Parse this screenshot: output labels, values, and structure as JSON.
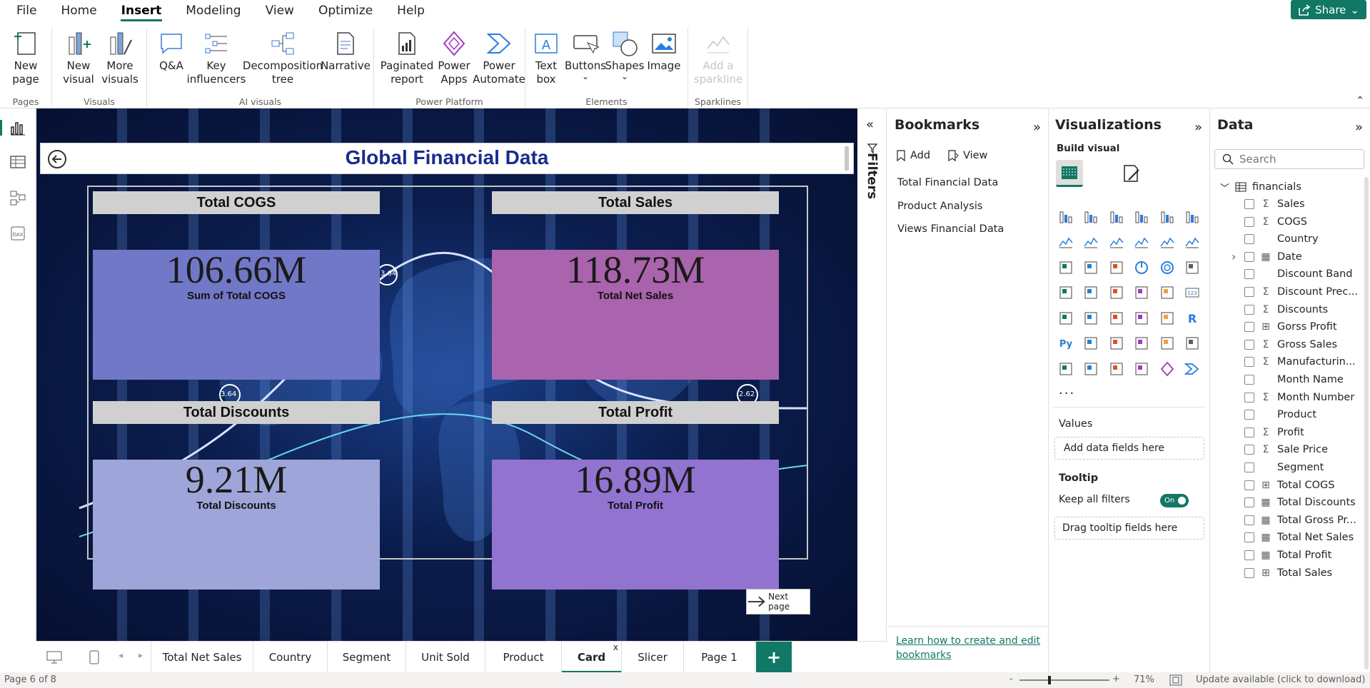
{
  "menu": {
    "items": [
      "File",
      "Home",
      "Insert",
      "Modeling",
      "View",
      "Optimize",
      "Help"
    ],
    "active": "Insert",
    "share_label": "Share"
  },
  "ribbon": {
    "groups": [
      {
        "label": "Pages",
        "buttons": [
          {
            "label": "New\npage"
          }
        ]
      },
      {
        "label": "Visuals",
        "buttons": [
          {
            "label": "New\nvisual"
          },
          {
            "label": "More\nvisuals"
          }
        ]
      },
      {
        "label": "AI visuals",
        "buttons": [
          {
            "label": "Q&A"
          },
          {
            "label": "Key\ninfluencers"
          },
          {
            "label": "Decomposition\ntree"
          },
          {
            "label": "Narrative"
          }
        ]
      },
      {
        "label": "Power Platform",
        "buttons": [
          {
            "label": "Paginated\nreport"
          },
          {
            "label": "Power\nApps"
          },
          {
            "label": "Power\nAutomate"
          }
        ]
      },
      {
        "label": "Elements",
        "buttons": [
          {
            "label": "Text\nbox"
          },
          {
            "label": "Buttons"
          },
          {
            "label": "Shapes"
          },
          {
            "label": "Image"
          }
        ]
      },
      {
        "label": "Sparklines",
        "buttons": [
          {
            "label": "Add a\nsparkline"
          }
        ]
      }
    ]
  },
  "report": {
    "title": "Global Financial Data",
    "cards": [
      {
        "header": "Total COGS",
        "value": "106.66M",
        "label": "Sum of Total COGS",
        "color": "#7178c7"
      },
      {
        "header": "Total Sales",
        "value": "118.73M",
        "label": "Total Net Sales",
        "color": "#a964ad"
      },
      {
        "header": "Total Discounts",
        "value": "9.21M",
        "label": "Total Discounts",
        "color": "#9ea5d8"
      },
      {
        "header": "Total Profit",
        "value": "16.89M",
        "label": "Total Profit",
        "color": "#9273d0"
      }
    ],
    "bg_markers": [
      "3.64",
      "3.64",
      "2.62"
    ],
    "next_button_label": "Next page"
  },
  "filters": {
    "label": "Filters"
  },
  "bookmarks": {
    "title": "Bookmarks",
    "add_label": "Add",
    "view_label": "View",
    "items": [
      "Total Financial Data",
      "Product Analysis",
      "Views Financial Data"
    ],
    "learn_link": "Learn how to create and edit bookmarks"
  },
  "visualizations": {
    "title": "Visualizations",
    "build_label": "Build visual",
    "more": "...",
    "values_label": "Values",
    "values_placeholder": "Add data fields here",
    "tooltip_label": "Tooltip",
    "keep_filters_label": "Keep all filters",
    "toggle_label": "On",
    "tooltip_placeholder": "Drag tooltip fields here"
  },
  "data": {
    "title": "Data",
    "search_placeholder": "Search",
    "table_name": "financials",
    "fields": [
      {
        "name": "Sales",
        "type": "Σ"
      },
      {
        "name": "COGS",
        "type": "Σ"
      },
      {
        "name": "Country",
        "type": ""
      },
      {
        "name": "Date",
        "type": "▦"
      },
      {
        "name": "Discount Band",
        "type": ""
      },
      {
        "name": "Discount Prec...",
        "type": "Σ"
      },
      {
        "name": "Discounts",
        "type": "Σ"
      },
      {
        "name": "Gorss Profit",
        "type": "⊞"
      },
      {
        "name": "Gross Sales",
        "type": "Σ"
      },
      {
        "name": "Manufacturin...",
        "type": "Σ"
      },
      {
        "name": "Month Name",
        "type": ""
      },
      {
        "name": "Month Number",
        "type": "Σ"
      },
      {
        "name": "Product",
        "type": ""
      },
      {
        "name": "Profit",
        "type": "Σ"
      },
      {
        "name": "Sale Price",
        "type": "Σ"
      },
      {
        "name": "Segment",
        "type": ""
      },
      {
        "name": "Total COGS",
        "type": "⊞"
      },
      {
        "name": "Total Discounts",
        "type": "▦"
      },
      {
        "name": "Total Gross Pr...",
        "type": "▦"
      },
      {
        "name": "Total Net Sales",
        "type": "▦"
      },
      {
        "name": "Total Profit",
        "type": "▦"
      },
      {
        "name": "Total Sales",
        "type": "⊞"
      }
    ]
  },
  "tabs": {
    "items": [
      "Total Net Sales",
      "Country",
      "Segment",
      "Unit Sold",
      "Product",
      "Card",
      "Slicer",
      "Page 1"
    ],
    "active": "Card",
    "close_label": "x",
    "add_label": "+"
  },
  "status": {
    "page_info": "Page 6 of 8",
    "zoom": "71%",
    "zoom_minus": "-",
    "zoom_plus": "+",
    "update_text": "Update available (click to download)"
  },
  "colors": {
    "accent": "#117865",
    "title": "#1a2c8c"
  }
}
